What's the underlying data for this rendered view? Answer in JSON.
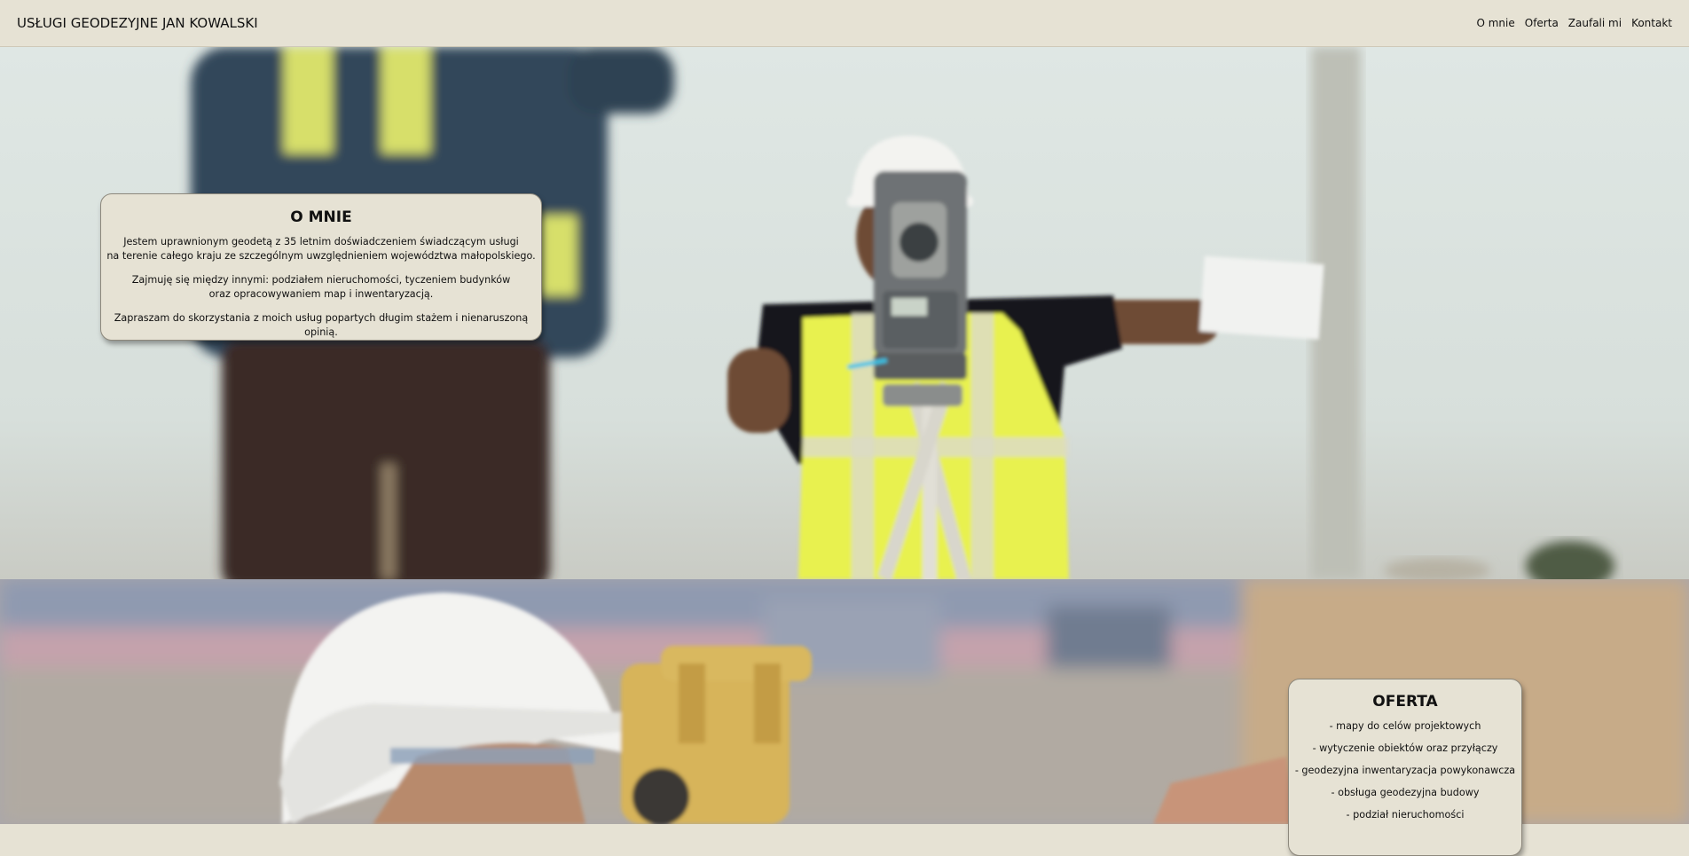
{
  "navbar": {
    "brand": "USŁUGI GEODEZYJNE JAN KOWALSKI",
    "links": [
      {
        "label": "O mnie"
      },
      {
        "label": "Oferta"
      },
      {
        "label": "Zaufali mi"
      },
      {
        "label": "Kontakt"
      }
    ]
  },
  "about": {
    "title": "O MNIE",
    "paragraph1_line1": "Jestem uprawnionym geodetą z 35 letnim doświadczeniem świadczącym usługi",
    "paragraph1_line2": "na terenie całego kraju ze szczególnym uwzględnieniem województwa małopolskiego.",
    "paragraph2_line1": "Zajmuję się między innymi: podziałem nieruchomości, tyczeniem budynków",
    "paragraph2_line2": "oraz opracowywaniem map i inwentaryzacją.",
    "paragraph3": "Zapraszam do skorzystania z moich usług popartych długim stażem i nienaruszoną opinią."
  },
  "offer": {
    "title": "OFERTA",
    "items": [
      "- mapy do celów projektowych",
      "- wytyczenie obiektów oraz przyłączy",
      "- geodezyjna inwentaryzacja powykonawcza",
      "- obsługa geodezyjna budowy",
      "- podział nieruchomości"
    ]
  },
  "colors": {
    "navbar_background": "#e6e2d4",
    "card_background": "#e6e2d4",
    "text": "#111111"
  },
  "images": {
    "about_background": "surveyor-with-total-station-photo",
    "offer_background": "surveyor-with-hardhat-photo"
  }
}
